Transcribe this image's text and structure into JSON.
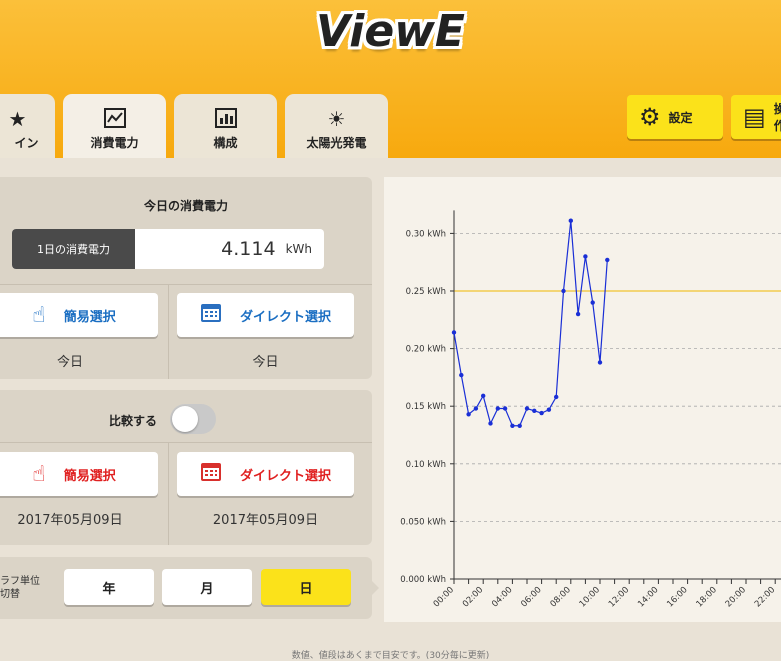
{
  "app": {
    "logo": "ViewE"
  },
  "tabs": [
    {
      "label": "イン",
      "icon": "★"
    },
    {
      "label": "消費電力",
      "icon": "〽"
    },
    {
      "label": "構成",
      "icon": "▦"
    },
    {
      "label": "太陽光発電",
      "icon": "☀"
    }
  ],
  "top_buttons": {
    "settings": "設定",
    "settings_icon": "⚙",
    "manual": "操作",
    "manual_icon": "▤"
  },
  "today_panel": {
    "title": "今日の消費電力",
    "daily_label": "1日の消費電力",
    "value": "4.114",
    "unit": "kWh",
    "simple_select": "簡易選択",
    "direct_select": "ダイレクト選択",
    "simple_date": "今日",
    "direct_date": "今日"
  },
  "compare_panel": {
    "title": "比較する",
    "toggle_on": false,
    "simple_select": "簡易選択",
    "direct_select": "ダイレクト選択",
    "simple_date": "2017年05月09日",
    "direct_date": "2017年05月09日"
  },
  "unit_panel": {
    "label_line1": "ラフ単位",
    "label_line2": "切替",
    "year": "年",
    "month": "月",
    "day": "日",
    "selected": "日"
  },
  "footer": "数値、値段はあくまで目安です。(30分毎に更新)",
  "colors": {
    "accent": "#f7a90e",
    "yellow_button": "#fbe21a",
    "line": "#1a2fd6",
    "reference": "#f0b800",
    "blue_text": "#1a6ec2",
    "red_text": "#e02020"
  },
  "chart_data": {
    "type": "line",
    "y_tick_labels": [
      "0.000 kWh",
      "0.050 kWh",
      "0.10 kWh",
      "0.15 kWh",
      "0.20 kWh",
      "0.25 kWh",
      "0.30 kWh"
    ],
    "y_ticks": [
      0,
      0.05,
      0.1,
      0.15,
      0.2,
      0.25,
      0.3
    ],
    "ylim": [
      0,
      0.32
    ],
    "x_tick_labels": [
      "00:00",
      "02:00",
      "04:00",
      "06:00",
      "08:00",
      "10:00",
      "12:00",
      "14:00",
      "16:00",
      "18:00",
      "20:00",
      "22:00"
    ],
    "x_ticks_hours": [
      0,
      2,
      4,
      6,
      8,
      10,
      12,
      14,
      16,
      18,
      20,
      22
    ],
    "xlim_hours": [
      0,
      22.5
    ],
    "reference_line": 0.25,
    "grid": "horizontal-dashed",
    "series": [
      {
        "x_hours": [
          0,
          0.5,
          1,
          1.5,
          2,
          2.5,
          3,
          3.5,
          4,
          4.5,
          5,
          5.5,
          6,
          6.5,
          7,
          7.5,
          8,
          8.5,
          9,
          9.5,
          10,
          10.5
        ],
        "values": [
          0.214,
          0.177,
          0.143,
          0.148,
          0.159,
          0.135,
          0.148,
          0.148,
          0.133,
          0.133,
          0.148,
          0.146,
          0.144,
          0.147,
          0.158,
          0.25,
          0.311,
          0.23,
          0.28,
          0.24,
          0.188,
          0.277
        ]
      }
    ]
  }
}
